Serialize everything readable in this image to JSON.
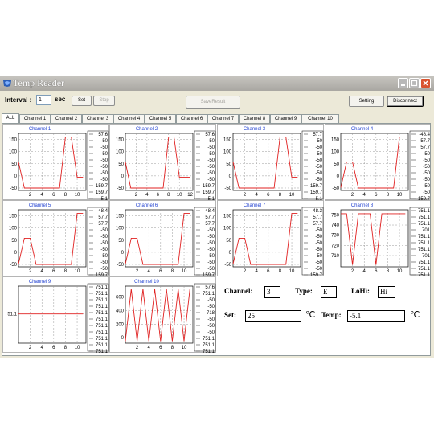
{
  "window": {
    "title": "Temp Reader"
  },
  "toolbar": {
    "interval_label": "Interval :",
    "interval_value": "1",
    "interval_unit": "sec",
    "set_label": "Set",
    "stop_label": "Stop",
    "save_label": "SaveResult",
    "setting_label": "Setting",
    "disconnect_label": "Disconnect"
  },
  "tabs": [
    "ALL",
    "Channel 1",
    "Channel 2",
    "Channel 3",
    "Channel 4",
    "Channel 5",
    "Channel 6",
    "Channel 7",
    "Channel 8",
    "Channel 9",
    "Channel 10"
  ],
  "active_tab": 0,
  "colors": {
    "line": "#e02020",
    "title": "#1f3fd0",
    "window_bg": "#ece9d8"
  },
  "chart_data": [
    {
      "type": "line",
      "title": "Channel 1",
      "x": [
        0,
        1,
        2,
        3,
        4,
        5,
        6,
        7,
        8,
        9,
        10,
        11
      ],
      "values": [
        57.6,
        -50,
        -50,
        -50,
        -50,
        -50,
        -50,
        -50,
        159.7,
        159.7,
        -5.1,
        -5.1
      ],
      "xticks": [
        "2",
        "4",
        "6",
        "8",
        "10"
      ],
      "xtick_values": [
        2,
        4,
        6,
        8,
        10
      ],
      "yticks": [
        "150",
        "100",
        "50",
        "0",
        "-50"
      ],
      "ytick_values": [
        150,
        100,
        50,
        0,
        -50
      ],
      "xlim": [
        0,
        11.5
      ],
      "ylim": [
        -60,
        175
      ],
      "legend": [
        "57.6",
        "-50",
        "-50",
        "-50",
        "-50",
        "-50",
        "-50",
        "-50",
        "159.7",
        "159.7",
        "-5.1"
      ]
    },
    {
      "type": "line",
      "title": "Channel 2",
      "x": [
        0,
        1,
        2,
        3,
        4,
        5,
        6,
        7,
        8,
        9,
        10,
        11,
        12
      ],
      "values": [
        57.6,
        -50,
        -50,
        -50,
        -50,
        -50,
        -50,
        -50,
        159.7,
        159.7,
        -5.1,
        -5.1,
        -5.1
      ],
      "xticks": [
        "2",
        "4",
        "6",
        "8",
        "10",
        "12"
      ],
      "xtick_values": [
        2,
        4,
        6,
        8,
        10,
        12
      ],
      "yticks": [
        "150",
        "100",
        "50",
        "0",
        "-50"
      ],
      "ytick_values": [
        150,
        100,
        50,
        0,
        -50
      ],
      "xlim": [
        0,
        12.5
      ],
      "ylim": [
        -60,
        175
      ],
      "legend": [
        "57.6",
        "-50",
        "-50",
        "-50",
        "-50",
        "-50",
        "-50",
        "-50",
        "159.7",
        "159.7",
        "-5.1"
      ]
    },
    {
      "type": "line",
      "title": "Channel 3",
      "x": [
        0,
        1,
        2,
        3,
        4,
        5,
        6,
        7,
        8,
        9,
        10,
        11
      ],
      "values": [
        57.7,
        -50,
        -50,
        -50,
        -50,
        -50,
        -50,
        -50,
        159.7,
        159.7,
        -5.1,
        -5.1
      ],
      "xticks": [
        "2",
        "4",
        "6",
        "8",
        "10"
      ],
      "xtick_values": [
        2,
        4,
        6,
        8,
        10
      ],
      "yticks": [
        "150",
        "100",
        "50",
        "0",
        "-50"
      ],
      "ytick_values": [
        150,
        100,
        50,
        0,
        -50
      ],
      "xlim": [
        0,
        11.5
      ],
      "ylim": [
        -60,
        175
      ],
      "legend": [
        "57.7",
        "-50",
        "-50",
        "-50",
        "-50",
        "-50",
        "-50",
        "-50",
        "159.7",
        "159.7",
        "-5.1"
      ]
    },
    {
      "type": "line",
      "title": "Channel 4",
      "x": [
        0,
        1,
        2,
        3,
        4,
        5,
        6,
        7,
        8,
        9,
        10,
        11
      ],
      "values": [
        -48.4,
        57.7,
        57.7,
        -50,
        -50,
        -50,
        -50,
        -50,
        -50,
        -50,
        159.7,
        159.7
      ],
      "xticks": [
        "2",
        "4",
        "6",
        "8",
        "10"
      ],
      "xtick_values": [
        2,
        4,
        6,
        8,
        10
      ],
      "yticks": [
        "150",
        "100",
        "50",
        "0",
        "-50"
      ],
      "ytick_values": [
        150,
        100,
        50,
        0,
        -50
      ],
      "xlim": [
        0,
        11.5
      ],
      "ylim": [
        -60,
        175
      ],
      "legend": [
        "-48.4",
        "57.7",
        "57.7",
        "-50",
        "-50",
        "-50",
        "-50",
        "-50",
        "-50",
        "-50",
        "159.7"
      ]
    },
    {
      "type": "line",
      "title": "Channel 5",
      "x": [
        0,
        1,
        2,
        3,
        4,
        5,
        6,
        7,
        8,
        9,
        10,
        11
      ],
      "values": [
        -48.4,
        57.7,
        57.7,
        -50,
        -50,
        -50,
        -50,
        -50,
        -50,
        -50,
        159.7,
        159.7
      ],
      "xticks": [
        "2",
        "4",
        "6",
        "8",
        "10"
      ],
      "xtick_values": [
        2,
        4,
        6,
        8,
        10
      ],
      "yticks": [
        "150",
        "100",
        "50",
        "0",
        "-50"
      ],
      "ytick_values": [
        150,
        100,
        50,
        0,
        -50
      ],
      "xlim": [
        0,
        11.5
      ],
      "ylim": [
        -60,
        175
      ],
      "legend": [
        "-48.4",
        "57.7",
        "57.7",
        "-50",
        "-50",
        "-50",
        "-50",
        "-50",
        "-50",
        "-50",
        "159.7"
      ]
    },
    {
      "type": "line",
      "title": "Channel 6",
      "x": [
        0,
        1,
        2,
        3,
        4,
        5,
        6,
        7,
        8,
        9,
        10,
        11
      ],
      "values": [
        -48.4,
        57.7,
        57.7,
        -50,
        -50,
        -50,
        -50,
        -50,
        -50,
        -50,
        159.7,
        159.7
      ],
      "xticks": [
        "2",
        "4",
        "6",
        "8",
        "10"
      ],
      "xtick_values": [
        2,
        4,
        6,
        8,
        10
      ],
      "yticks": [
        "150",
        "100",
        "50",
        "0",
        "-50"
      ],
      "ytick_values": [
        150,
        100,
        50,
        0,
        -50
      ],
      "xlim": [
        0,
        11.5
      ],
      "ylim": [
        -60,
        175
      ],
      "legend": [
        "-48.4",
        "57.7",
        "57.7",
        "-50",
        "-50",
        "-50",
        "-50",
        "-50",
        "-50",
        "-50",
        "159.7"
      ]
    },
    {
      "type": "line",
      "title": "Channel 7",
      "x": [
        0,
        1,
        2,
        3,
        4,
        5,
        6,
        7,
        8,
        9,
        10,
        11
      ],
      "values": [
        -48.3,
        57.7,
        57.7,
        -50,
        -50,
        -50,
        -50,
        -50,
        -50,
        -50,
        159.7,
        159.7
      ],
      "xticks": [
        "2",
        "4",
        "6",
        "8",
        "10"
      ],
      "xtick_values": [
        2,
        4,
        6,
        8,
        10
      ],
      "yticks": [
        "150",
        "100",
        "50",
        "0",
        "-50"
      ],
      "ytick_values": [
        150,
        100,
        50,
        0,
        -50
      ],
      "xlim": [
        0,
        11.5
      ],
      "ylim": [
        -60,
        175
      ],
      "legend": [
        "-48.3",
        "57.7",
        "57.7",
        "-50",
        "-50",
        "-50",
        "-50",
        "-50",
        "-50",
        "-50",
        "159.7"
      ]
    },
    {
      "type": "line",
      "title": "Channel 8",
      "x": [
        0,
        1,
        2,
        3,
        4,
        5,
        6,
        7,
        8,
        9,
        10,
        11
      ],
      "values": [
        751.1,
        751.1,
        701,
        751.1,
        751.1,
        751.1,
        701,
        751.1,
        751.1,
        751.1,
        751.1,
        751.1
      ],
      "xticks": [
        "2",
        "4",
        "6",
        "8",
        "10"
      ],
      "xtick_values": [
        2,
        4,
        6,
        8,
        10
      ],
      "yticks": [
        "750",
        "740",
        "730",
        "720",
        "710"
      ],
      "ytick_values": [
        750,
        740,
        730,
        720,
        710
      ],
      "xlim": [
        0,
        11.5
      ],
      "ylim": [
        699,
        755
      ],
      "legend": [
        "751.1",
        "751.1",
        "751.1",
        "701",
        "751.1",
        "751.1",
        "751.1",
        "701",
        "751.1",
        "751.1",
        "751.1"
      ]
    },
    {
      "type": "line",
      "title": "Channel 9",
      "x": [
        0,
        1,
        2,
        3,
        4,
        5,
        6,
        7,
        8,
        9,
        10,
        11
      ],
      "values": [
        751.1,
        751.1,
        751.1,
        751.1,
        751.1,
        751.1,
        751.1,
        751.1,
        751.1,
        751.1,
        751.1,
        751.1
      ],
      "xticks": [
        "2",
        "4",
        "6",
        "8",
        "10"
      ],
      "xtick_values": [
        2,
        4,
        6,
        8,
        10
      ],
      "yticks": [
        "51.1"
      ],
      "ytick_values": [
        751.1
      ],
      "xlim": [
        0,
        11.5
      ],
      "ylim": [
        700,
        800
      ],
      "legend": [
        "751.1",
        "751.1",
        "751.1",
        "751.1",
        "751.1",
        "751.1",
        "751.1",
        "751.1",
        "751.1",
        "751.1",
        "751.1"
      ]
    },
    {
      "type": "line",
      "title": "Channel 10",
      "x": [
        0,
        1,
        2,
        3,
        4,
        5,
        6,
        7,
        8,
        9,
        10,
        11
      ],
      "values": [
        -50,
        718,
        -50,
        718,
        -50,
        718,
        -50,
        718,
        -50,
        718,
        -50,
        718
      ],
      "xticks": [
        "2",
        "4",
        "6",
        "8",
        "10"
      ],
      "xtick_values": [
        2,
        4,
        6,
        8,
        10
      ],
      "yticks": [
        "600",
        "400",
        "200",
        "0"
      ],
      "ytick_values": [
        600,
        400,
        200,
        0
      ],
      "xlim": [
        0,
        11.5
      ],
      "ylim": [
        -80,
        760
      ],
      "legend": [
        "57.6",
        "751.1",
        "-50",
        "-50",
        "718",
        "-50",
        "-50",
        "-50",
        "751.1",
        "751.1",
        "751.1"
      ]
    }
  ],
  "fields": {
    "channel_label": "Channel:",
    "channel_value": "3",
    "type_label": "Type:",
    "type_value": "E",
    "lohi_label": "LoHi:",
    "lohi_value": "Hi",
    "set_label": "Set:",
    "set_value": "25",
    "temp_label": "Temp:",
    "temp_value": "-5.1",
    "unit": "℃"
  }
}
